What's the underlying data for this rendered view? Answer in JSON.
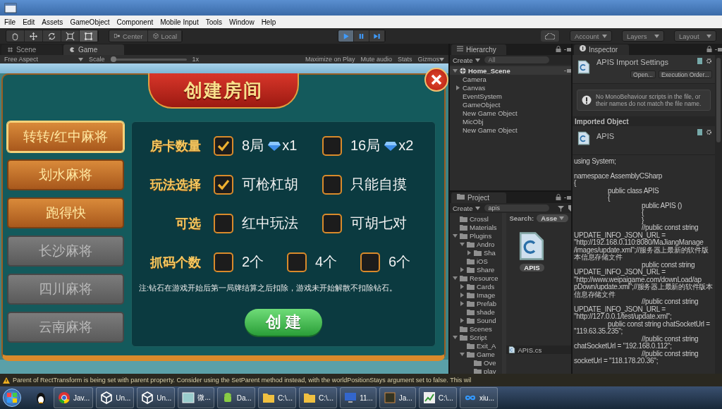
{
  "menu": [
    "File",
    "Edit",
    "Assets",
    "GameObject",
    "Component",
    "Mobile Input",
    "Tools",
    "Window",
    "Help"
  ],
  "toolbar": {
    "tools": [
      {
        "selected": false
      },
      {
        "selected": false
      },
      {
        "selected": false
      },
      {
        "selected": false
      },
      {
        "selected": true
      }
    ],
    "pivot": [
      "Center",
      "Local"
    ],
    "play": [
      {
        "on": true
      },
      {
        "on": false
      },
      {
        "on": false
      }
    ],
    "menus": [
      "Account",
      "Layers",
      "Layout"
    ]
  },
  "game_panel": {
    "tabs": [
      {
        "label": "Scene",
        "selected": false
      },
      {
        "label": "Game",
        "selected": true
      }
    ],
    "aspect": "Free Aspect",
    "scale_label": "Scale",
    "scale": {
      "level": 0
    },
    "scale_value": "1x",
    "toggles": [
      "Maximize on Play",
      "Mute audio",
      "Stats",
      "Gizmos"
    ]
  },
  "dialog": {
    "title": "创建房间",
    "modes": [
      {
        "label": "转转/红中麻将",
        "selected": true,
        "disabled": false
      },
      {
        "label": "划水麻将",
        "selected": false,
        "disabled": false
      },
      {
        "label": "跑得快",
        "selected": false,
        "disabled": false
      },
      {
        "label": "长沙麻将",
        "selected": false,
        "disabled": true
      },
      {
        "label": "四川麻将",
        "selected": false,
        "disabled": true
      },
      {
        "label": "云南麻将",
        "selected": false,
        "disabled": true
      }
    ],
    "rows": [
      {
        "label": "房卡数量",
        "options": [
          {
            "text": "8局",
            "cost": "x1",
            "checked": true
          },
          {
            "text": "16局",
            "cost": "x2",
            "checked": false
          }
        ]
      },
      {
        "label": "玩法选择",
        "options": [
          {
            "text": "可枪杠胡",
            "checked": true
          },
          {
            "text": "只能自摸",
            "checked": false
          }
        ]
      },
      {
        "label": "可选",
        "options": [
          {
            "text": "红中玩法",
            "checked": false
          },
          {
            "text": "可胡七对",
            "checked": false
          }
        ]
      },
      {
        "label": "抓码个数",
        "options": [
          {
            "text": "2个",
            "checked": false
          },
          {
            "text": "4个",
            "checked": false
          },
          {
            "text": "6个",
            "checked": false
          }
        ]
      }
    ],
    "note": "注:钻石在游戏开始后第一局牌结算之后扣除，游戏未开始解散不扣除钻石。",
    "create_button": "创 建"
  },
  "hierarchy": {
    "title": "Hierarchy",
    "create": "Create",
    "search_placeholder": "All",
    "scene": {
      "label": "Home_Scene",
      "expanded": true,
      "children": [
        {
          "label": "Camera"
        },
        {
          "label": "Canvas",
          "expanded": false
        },
        {
          "label": "EventSystem"
        },
        {
          "label": "GameObject"
        },
        {
          "label": "New Game Object"
        },
        {
          "label": "MicObj"
        },
        {
          "label": "New Game Object"
        }
      ]
    }
  },
  "project": {
    "title": "Project",
    "create": "Create",
    "search_value": "apis",
    "folders": [
      {
        "label": "Crossl"
      },
      {
        "label": "Materials"
      },
      {
        "label": "Plugins",
        "expanded": true,
        "children": [
          {
            "label": "Andro",
            "expanded": true,
            "children": [
              {
                "label": "Sha",
                "expanded": false
              }
            ]
          },
          {
            "label": "iOS"
          },
          {
            "label": "Share",
            "expanded": false
          }
        ]
      },
      {
        "label": "Resource",
        "expanded": true,
        "children": [
          {
            "label": "Cards",
            "expanded": false
          },
          {
            "label": "Image",
            "expanded": false
          },
          {
            "label": "Prefab",
            "expanded": false
          },
          {
            "label": "shade"
          },
          {
            "label": "Sound",
            "expanded": false
          }
        ]
      },
      {
        "label": "Scenes"
      },
      {
        "label": "Script",
        "expanded": true,
        "children": [
          {
            "label": "Exit_A"
          },
          {
            "label": "Game",
            "expanded": true,
            "children": [
              {
                "label": "Ove"
              },
              {
                "label": "play"
              }
            ]
          }
        ]
      }
    ],
    "search_label": "Search:",
    "scope": "Asse",
    "asset": {
      "label": "APIS",
      "selected": true
    },
    "path": "APIS.cs"
  },
  "inspector": {
    "title": "Inspector",
    "header": "APIS Import Settings",
    "buttons": [
      "Open...",
      "Execution Order..."
    ],
    "help": "No MonoBehaviour scripts in the file, or their names do not match the file name.",
    "section": "Imported Object",
    "asset": "APIS",
    "code": [
      [
        "using System;"
      ],
      [
        "namespace AssemblyCSharp",
        "{",
        "\t\tpublic class APIS",
        "\t\t{",
        "\t\t\t\tpublic APIS ()",
        "\t\t\t\t{",
        "\t\t\t\t}",
        "\t\t\t\t//public const string",
        "UPDATE_INFO_JSON_URL =",
        "\"http://192.168.0.110:8080/MaJiangManage",
        "/images/update.xml\";//服务器上最新的软件版",
        "本信息存储文件",
        "\t\t\t\tpublic const string",
        "UPDATE_INFO_JSON_URL =",
        "\"http://www.weipaigame.com/downLoad/ap",
        "pDown/update.xml\";//服务器上最新的软件版本",
        "信息存储文件",
        "\t\t\t\t//public const string",
        "UPDATE_INFO_JSON_URL =",
        "\"http://127.0.0.1/test/update.xml\";",
        "\t\tpublic const string chatSocketUrl =",
        "\"119.63.35.235\";",
        "\t\t\t\t//public const string",
        "chatSocketUrl = \"192.168.0.112\";",
        "\t\t\t\t//public const string",
        "socketUrl = \"118.178.20.36\";"
      ]
    ]
  },
  "console": {
    "message": "Parent of RectTransform is being set with parent property. Consider using the SetParent method instead, with the worldPositionStays argument set to false. This wil"
  },
  "taskbar": [
    {
      "kind": "penguin"
    },
    {
      "kind": "browser",
      "label": "Jav..."
    },
    {
      "kind": "unity",
      "label": "Un..."
    },
    {
      "kind": "unity",
      "label": "Un..."
    },
    {
      "kind": "window",
      "label": "微..."
    },
    {
      "kind": "robot",
      "label": "Da..."
    },
    {
      "kind": "folder",
      "label": "C:\\..."
    },
    {
      "kind": "folder",
      "label": "C:\\..."
    },
    {
      "kind": "monitor",
      "label": "11..."
    },
    {
      "kind": "chip",
      "label": "Ja..."
    },
    {
      "kind": "chart",
      "label": "C:\\..."
    },
    {
      "kind": "infinity",
      "label": "xiu..."
    }
  ]
}
